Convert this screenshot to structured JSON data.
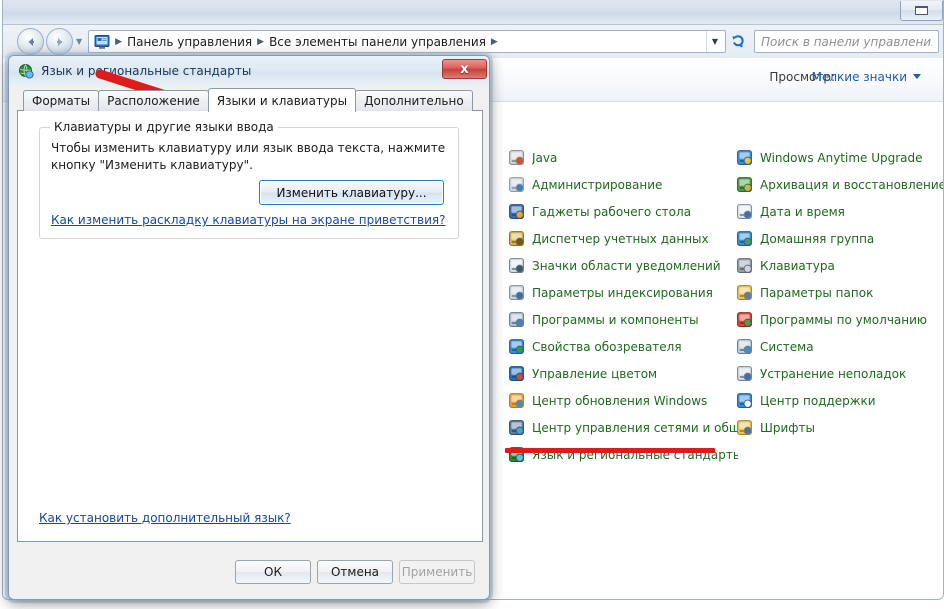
{
  "explorer": {
    "window_buttons": {
      "maximize": "maximize-button"
    },
    "nav": {
      "back": "Назад",
      "forward": "Вперед",
      "history": "Последние страницы"
    },
    "breadcrumbs": [
      "Панель управления",
      "Все элементы панели управления"
    ],
    "search": {
      "placeholder": "Поиск в панели управления",
      "value": ""
    },
    "refresh_label": "Обновить",
    "view": {
      "label": "Просмотр:",
      "value": "Мелкие значки"
    },
    "items_left": [
      {
        "label": "Java",
        "icon": "java-icon"
      },
      {
        "label": "Администрирование",
        "icon": "admin-tools-icon"
      },
      {
        "label": "Гаджеты рабочего стола",
        "icon": "gadgets-icon"
      },
      {
        "label": "Диспетчер учетных данных",
        "icon": "credential-manager-icon"
      },
      {
        "label": "Значки области уведомлений",
        "icon": "notification-icons-icon"
      },
      {
        "label": "Параметры индексирования",
        "icon": "indexing-options-icon"
      },
      {
        "label": "Программы и компоненты",
        "icon": "programs-features-icon"
      },
      {
        "label": "Свойства обозревателя",
        "icon": "internet-options-icon"
      },
      {
        "label": "Управление цветом",
        "icon": "color-management-icon"
      },
      {
        "label": "Центр обновления Windows",
        "icon": "windows-update-icon"
      },
      {
        "label": "Центр управления сетями и общи...",
        "icon": "network-sharing-icon"
      },
      {
        "label": "Язык и региональные стандарты",
        "icon": "region-language-icon"
      }
    ],
    "items_right": [
      {
        "label": "Windows Anytime Upgrade",
        "icon": "anytime-upgrade-icon"
      },
      {
        "label": "Архивация и восстановление",
        "icon": "backup-restore-icon"
      },
      {
        "label": "Дата и время",
        "icon": "date-time-icon"
      },
      {
        "label": "Домашняя группа",
        "icon": "homegroup-icon"
      },
      {
        "label": "Клавиатура",
        "icon": "keyboard-icon"
      },
      {
        "label": "Параметры папок",
        "icon": "folder-options-icon"
      },
      {
        "label": "Программы по умолчанию",
        "icon": "default-programs-icon"
      },
      {
        "label": "Система",
        "icon": "system-icon"
      },
      {
        "label": "Устранение неполадок",
        "icon": "troubleshooting-icon"
      },
      {
        "label": "Центр поддержки",
        "icon": "action-center-icon"
      },
      {
        "label": "Шрифты",
        "icon": "fonts-icon"
      }
    ]
  },
  "dialog": {
    "title": "Язык и региональные стандарты",
    "close_label": "x",
    "tabs": [
      {
        "label": "Форматы",
        "active": false
      },
      {
        "label": "Расположение",
        "active": false
      },
      {
        "label": "Языки и клавиатуры",
        "active": true
      },
      {
        "label": "Дополнительно",
        "active": false
      }
    ],
    "group": {
      "title": "Клавиатуры и другие языки ввода",
      "description": "Чтобы изменить клавиатуру или язык ввода текста, нажмите кнопку \"Изменить клавиатуру\".",
      "button": "Изменить клавиатуру...",
      "link": "Как изменить раскладку клавиатуры на экране приветствия?"
    },
    "bottom_link": "Как установить дополнительный язык?",
    "buttons": {
      "ok": "ОК",
      "cancel": "Отмена",
      "apply": "Применить"
    }
  },
  "annotations": {
    "accent_red": "#e01b1b",
    "arrow_to_tab": "arrow-pointing-to-languages-tab",
    "arrow_to_button": "arrow-pointing-to-change-keyboard-button",
    "underline_item": "underline-region-language-item"
  },
  "colors": {
    "item_text": "#1e6a1e",
    "link": "#15489e",
    "view_value": "#1c5dab",
    "title_text": "#15385c"
  }
}
